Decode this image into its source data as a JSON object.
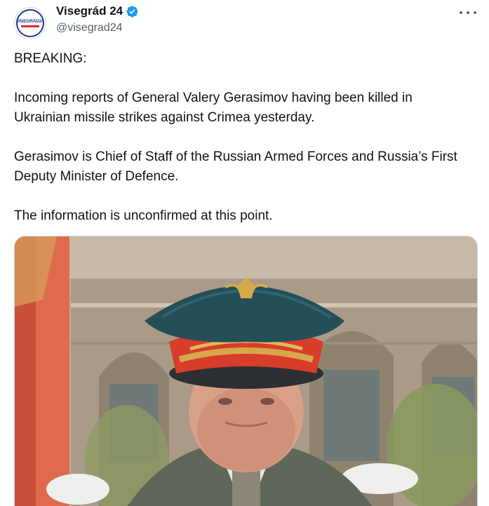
{
  "account": {
    "display_name": "Visegrád 24",
    "handle": "@visegrad24",
    "avatar_text": "VISEGRÁD24",
    "verified": true
  },
  "tweet": {
    "paragraphs": [
      "BREAKING:",
      "Incoming reports of General Valery Gerasimov having been killed in Ukrainian missile strikes against Crimea yesterday.",
      "Gerasimov is Chief of Staff of the Russian Armed Forces and Russia’s First Deputy Minister of Defence.",
      "The information is unconfirmed at this point."
    ]
  },
  "media": {
    "subject": "photo of a general in a peaked military cap in front of a building"
  },
  "icons": {
    "verified": "verified-badge-icon",
    "more": "more-options-icon"
  },
  "colors": {
    "verified_blue": "#1d9bf0",
    "text": "#0f1419",
    "secondary_text": "#536471"
  }
}
